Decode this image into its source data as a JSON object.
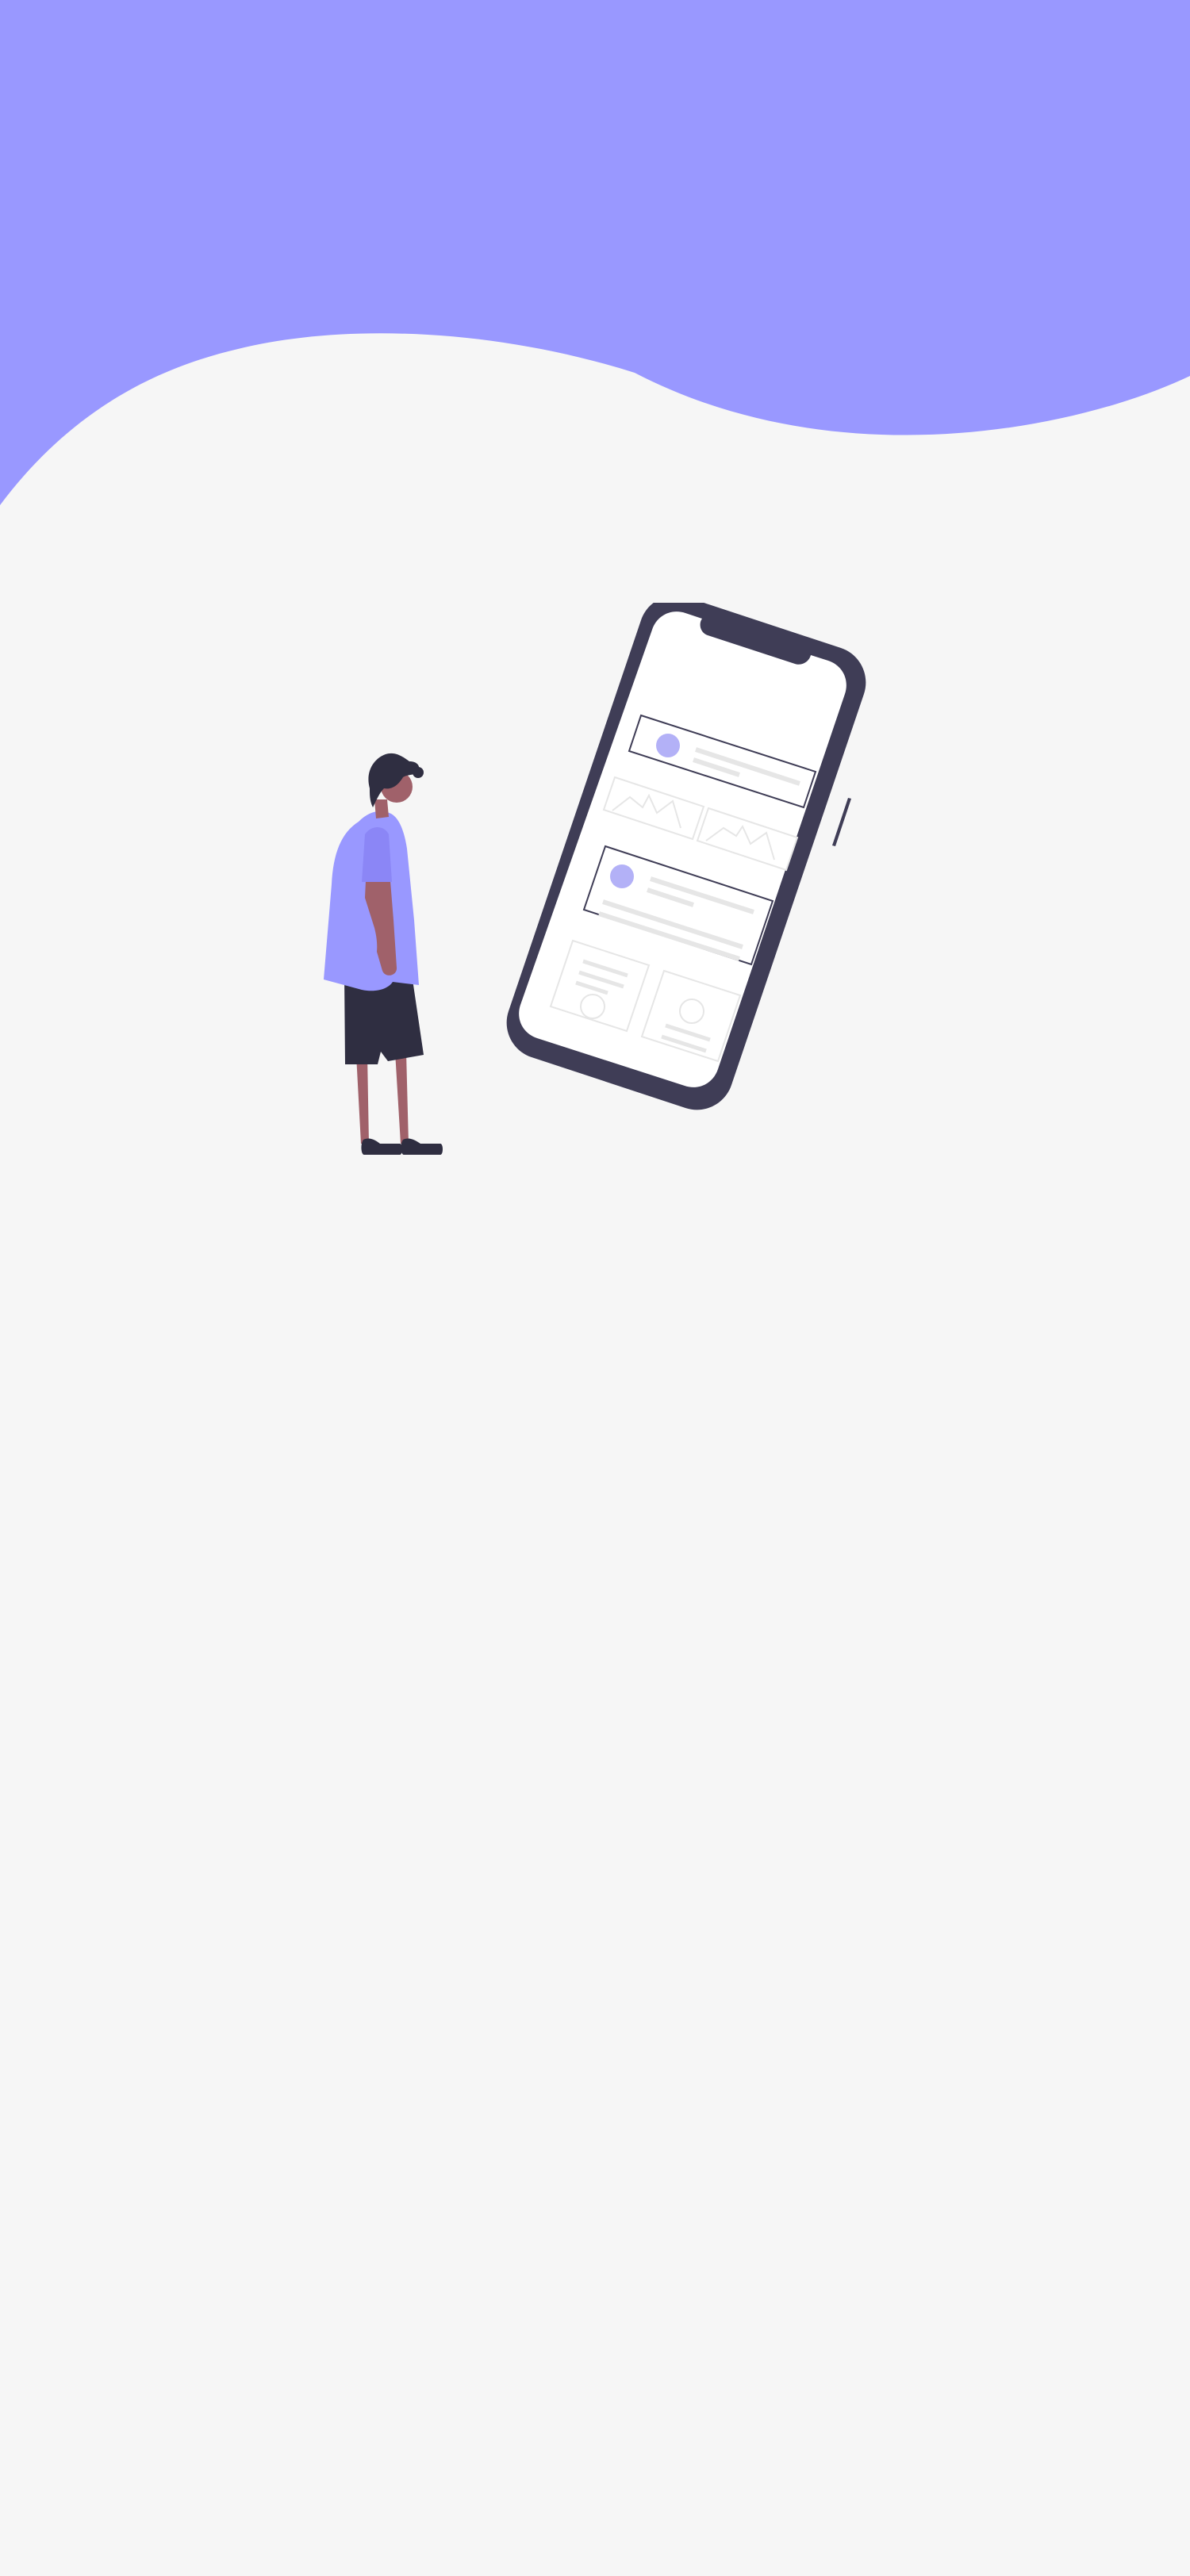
{
  "colors": {
    "background": "#f6f6f6",
    "accent": "#9998ff",
    "accent_muted": "#b3b1f7",
    "device_frame": "#3f3d56",
    "device_screen": "#ffffff",
    "skin": "#a0616a",
    "hair": "#2f2e41",
    "shorts": "#2f2e41",
    "card_border": "#3f3d56",
    "placeholder_line": "#e6e6e6",
    "faint_outline": "#e0e0e0"
  },
  "illustration": {
    "name": "person-looking-at-phone",
    "elements": [
      "phone-mockup",
      "person-figure"
    ]
  }
}
